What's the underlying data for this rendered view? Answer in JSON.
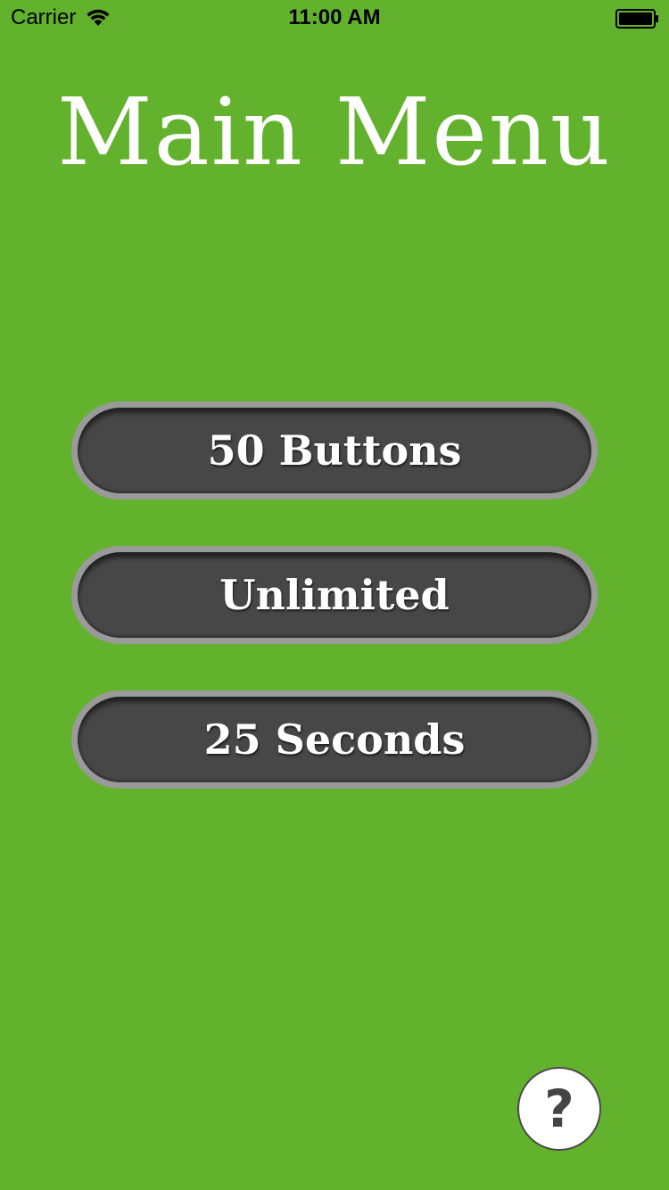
{
  "status_bar": {
    "carrier": "Carrier",
    "time": "11:00 AM",
    "wifi_icon": "wifi-icon",
    "battery_icon": "battery-icon"
  },
  "title": "Main Menu",
  "menu": {
    "buttons": [
      {
        "label": "50 Buttons"
      },
      {
        "label": "Unlimited"
      },
      {
        "label": "25 Seconds"
      }
    ]
  },
  "help": {
    "label": "?",
    "icon": "question-mark-icon"
  },
  "colors": {
    "background": "#63b22d",
    "button_fill": "#474747",
    "button_border": "#9a9a9a",
    "text": "#ffffff",
    "help_glyph": "#444444"
  }
}
